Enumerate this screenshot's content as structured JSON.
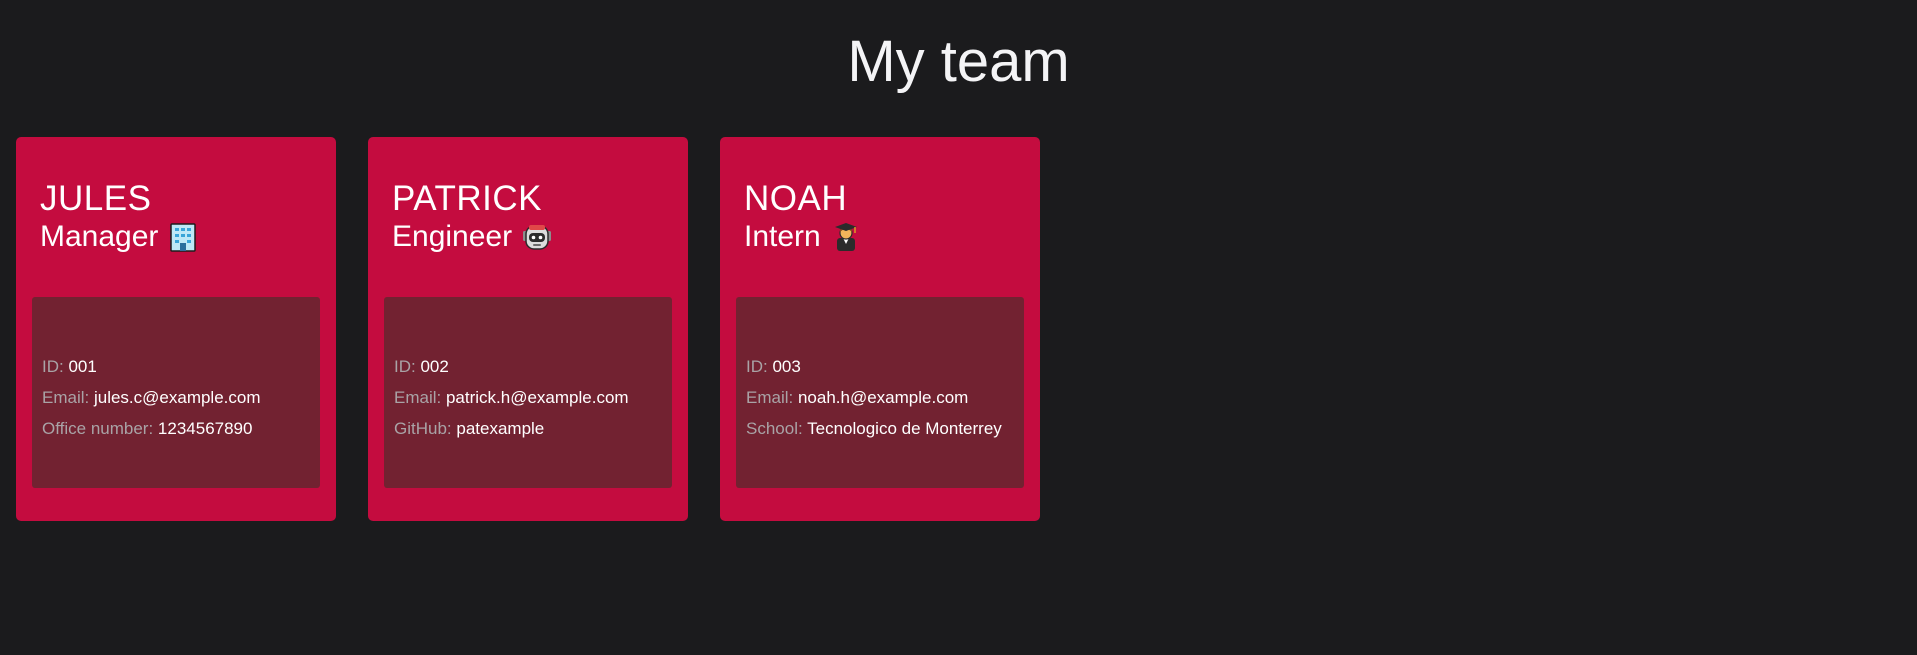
{
  "page": {
    "title": "My team"
  },
  "colors": {
    "background": "#1b1b1d",
    "card": "#c40c3f",
    "card_body": "#722231",
    "label": "#a9a3a6",
    "text": "#ffffff"
  },
  "team": [
    {
      "name": "JULES",
      "role": "Manager",
      "role_icon": "office-building-icon",
      "id_label": "ID:",
      "id": "001",
      "email_label": "Email:",
      "email": "jules.c@example.com",
      "extra_label": "Office number:",
      "extra_value": "1234567890"
    },
    {
      "name": "PATRICK",
      "role": "Engineer",
      "role_icon": "robot-icon",
      "id_label": "ID:",
      "id": "002",
      "email_label": "Email:",
      "email": "patrick.h@example.com",
      "extra_label": "GitHub:",
      "extra_value": "patexample"
    },
    {
      "name": "NOAH",
      "role": "Intern",
      "role_icon": "graduate-icon",
      "id_label": "ID:",
      "id": "003",
      "email_label": "Email:",
      "email": "noah.h@example.com",
      "extra_label": "School:",
      "extra_value": "Tecnologico de Monterrey"
    }
  ]
}
